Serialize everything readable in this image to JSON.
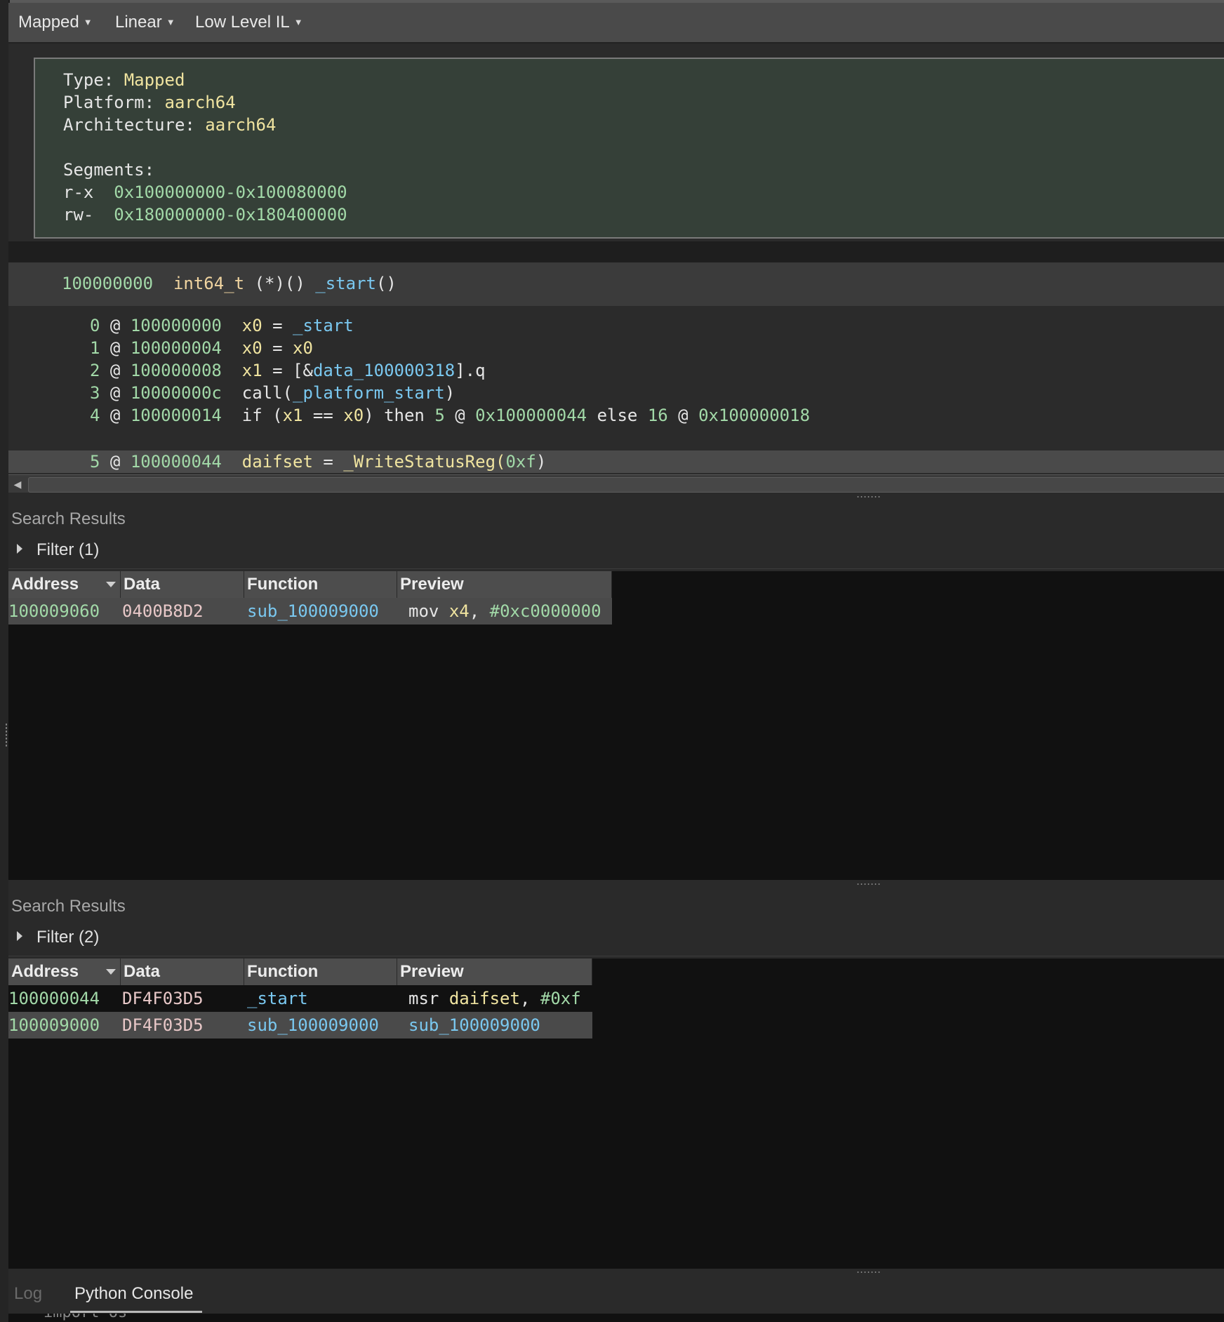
{
  "toolbar": {
    "view_type": "Mapped",
    "view_mode": "Linear",
    "il_level": "Low Level IL"
  },
  "header": {
    "type_label": "Type:",
    "type_value": "Mapped",
    "platform_label": "Platform:",
    "platform_value": "aarch64",
    "arch_label": "Architecture:",
    "arch_value": "aarch64",
    "segments_label": "Segments:",
    "segments": [
      {
        "perm": "r-x",
        "range": "0x100000000-0x100080000"
      },
      {
        "perm": "rw-",
        "range": "0x180000000-0x180400000"
      }
    ]
  },
  "function_header": {
    "address": "100000000",
    "ret_type": "int64_t",
    "sig_mid": "(*)()",
    "name": "_start",
    "paren": "()"
  },
  "il": {
    "l0": {
      "idx": "0",
      "addr": "100000000",
      "dest": "x0",
      "eq": "=",
      "src": "_start"
    },
    "l1": {
      "idx": "1",
      "addr": "100000004",
      "dest": "x0",
      "eq": "=",
      "src": "x0"
    },
    "l2": {
      "idx": "2",
      "addr": "100000008",
      "dest": "x1",
      "eq": "=",
      "pre": "[&",
      "sym": "data_100000318",
      "post": "].q"
    },
    "l3": {
      "idx": "3",
      "addr": "10000000c",
      "call": "call(",
      "sym": "_platform_start",
      "close": ")"
    },
    "l4": {
      "idx": "4",
      "addr": "100000014",
      "kw_if": "if (",
      "r1": "x1",
      "op": "==",
      "r2": "x0",
      "kw_then": ") then",
      "t_idx": "5",
      "t_addr": "0x100000044",
      "kw_else": "else",
      "e_idx": "16",
      "e_addr": "0x100000018"
    },
    "l5": {
      "idx": "5",
      "addr": "100000044",
      "dest": "daifset",
      "eq": "=",
      "fn": "_WriteStatusReg(",
      "arg": "0xf",
      "close": ")"
    }
  },
  "at": "@",
  "search1": {
    "title": "Search Results",
    "filter": "Filter (1)",
    "columns": [
      "Address",
      "Data",
      "Function",
      "Preview"
    ],
    "rows": [
      {
        "address": "100009060",
        "data": "0400B8D2",
        "function": "sub_100009000",
        "p_mnem": "mov",
        "p_reg": "x4",
        "p_comma": ",",
        "p_imm": "#0xc0000000"
      }
    ]
  },
  "search2": {
    "title": "Search Results",
    "filter": "Filter (2)",
    "columns": [
      "Address",
      "Data",
      "Function",
      "Preview"
    ],
    "rows": [
      {
        "address": "100000044",
        "data": "DF4F03D5",
        "function": "_start",
        "p_mnem": "msr",
        "p_reg": "daifset",
        "p_comma": ",",
        "p_imm": "#0xf"
      },
      {
        "address": "100009000",
        "data": "DF4F03D5",
        "function": "sub_100009000",
        "p_sym": "sub_100009000"
      }
    ]
  },
  "bottom_tabs": {
    "log": "Log",
    "python": "Python Console"
  },
  "console_partial": "import os"
}
